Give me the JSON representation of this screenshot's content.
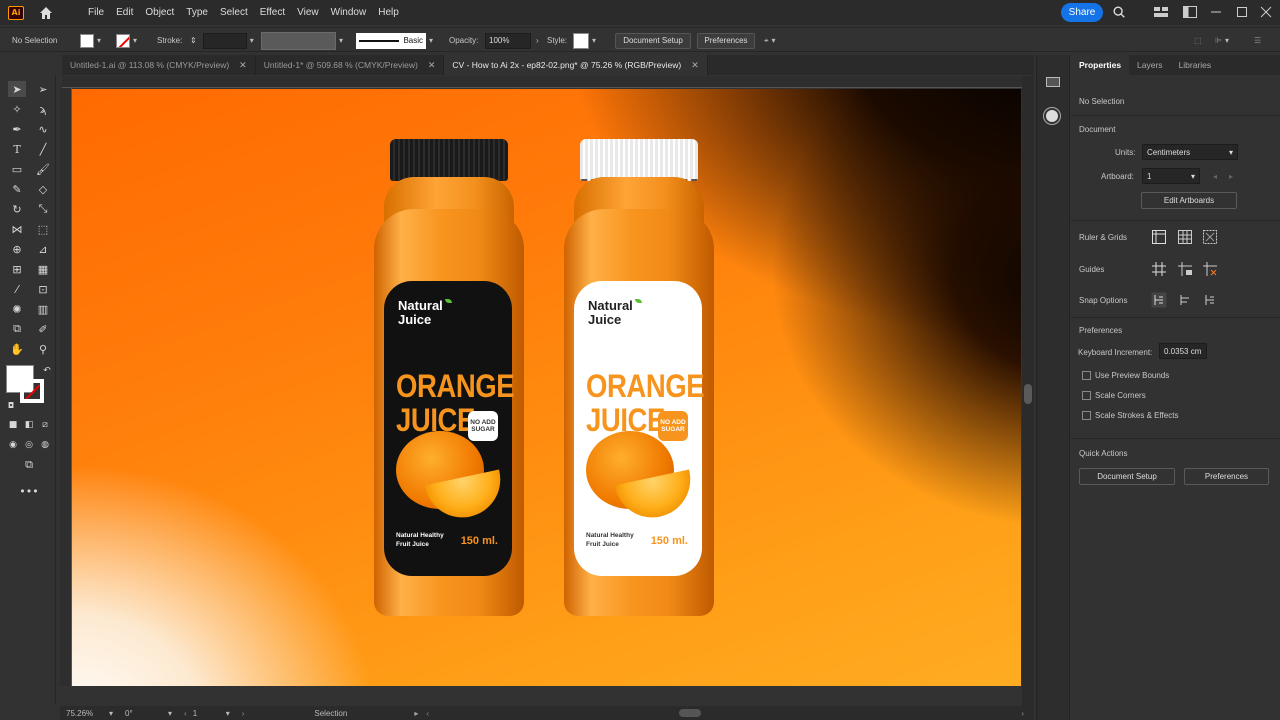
{
  "app": {
    "logo": "Ai",
    "menu": [
      "File",
      "Edit",
      "Object",
      "Type",
      "Select",
      "Effect",
      "View",
      "Window",
      "Help"
    ],
    "share_label": "Share"
  },
  "control_bar": {
    "selection_status": "No Selection",
    "stroke_label": "Stroke:",
    "brush_label": "Basic",
    "opacity_label": "Opacity:",
    "opacity_value": "100%",
    "style_label": "Style:",
    "document_setup_label": "Document Setup",
    "preferences_label": "Preferences"
  },
  "tabs": [
    {
      "label": "Untitled-1.ai @ 113.08 % (CMYK/Preview)",
      "active": false
    },
    {
      "label": "Untitled-1* @ 509.68 % (CMYK/Preview)",
      "active": false
    },
    {
      "label": "CV - How to Ai 2x - ep82-02.png* @ 75.26 % (RGB/Preview)",
      "active": true
    }
  ],
  "canvas": {
    "bottles": [
      {
        "brand_line1": "Natural",
        "brand_line2": "Juice",
        "product_line1": "ORANGE",
        "product_line2": "JUICE",
        "badge_line1": "NO ADD",
        "badge_line2": "SUGAR",
        "tagline_line1": "Natural Healthy",
        "tagline_line2": "Fruit Juice",
        "volume": "150 ml."
      },
      {
        "brand_line1": "Natural",
        "brand_line2": "Juice",
        "product_line1": "ORANGE",
        "product_line2": "JUICE",
        "badge_line1": "NO ADD",
        "badge_line2": "SUGAR",
        "tagline_line1": "Natural Healthy",
        "tagline_line2": "Fruit Juice",
        "volume": "150 ml."
      }
    ]
  },
  "status_bar": {
    "zoom": "75.26%",
    "rotation": "0°",
    "artboard": "1",
    "tool": "Selection"
  },
  "panel": {
    "tabs": [
      "Properties",
      "Layers",
      "Libraries"
    ],
    "no_selection": "No Selection",
    "document_heading": "Document",
    "units_label": "Units:",
    "units_value": "Centimeters",
    "artboard_label": "Artboard:",
    "artboard_value": "1",
    "edit_artboards": "Edit Artboards",
    "ruler_grids": "Ruler & Grids",
    "guides": "Guides",
    "snap_options": "Snap Options",
    "preferences_heading": "Preferences",
    "keyboard_increment_label": "Keyboard Increment:",
    "keyboard_increment_value": "0.0353 cm",
    "use_preview_bounds": "Use Preview Bounds",
    "scale_corners": "Scale Corners",
    "scale_strokes": "Scale Strokes & Effects",
    "quick_actions": "Quick Actions",
    "document_setup": "Document Setup",
    "preferences": "Preferences"
  },
  "colors": {
    "accent": "#1473e6",
    "brand_orange": "#f7941d",
    "ui_background": "#323232"
  }
}
